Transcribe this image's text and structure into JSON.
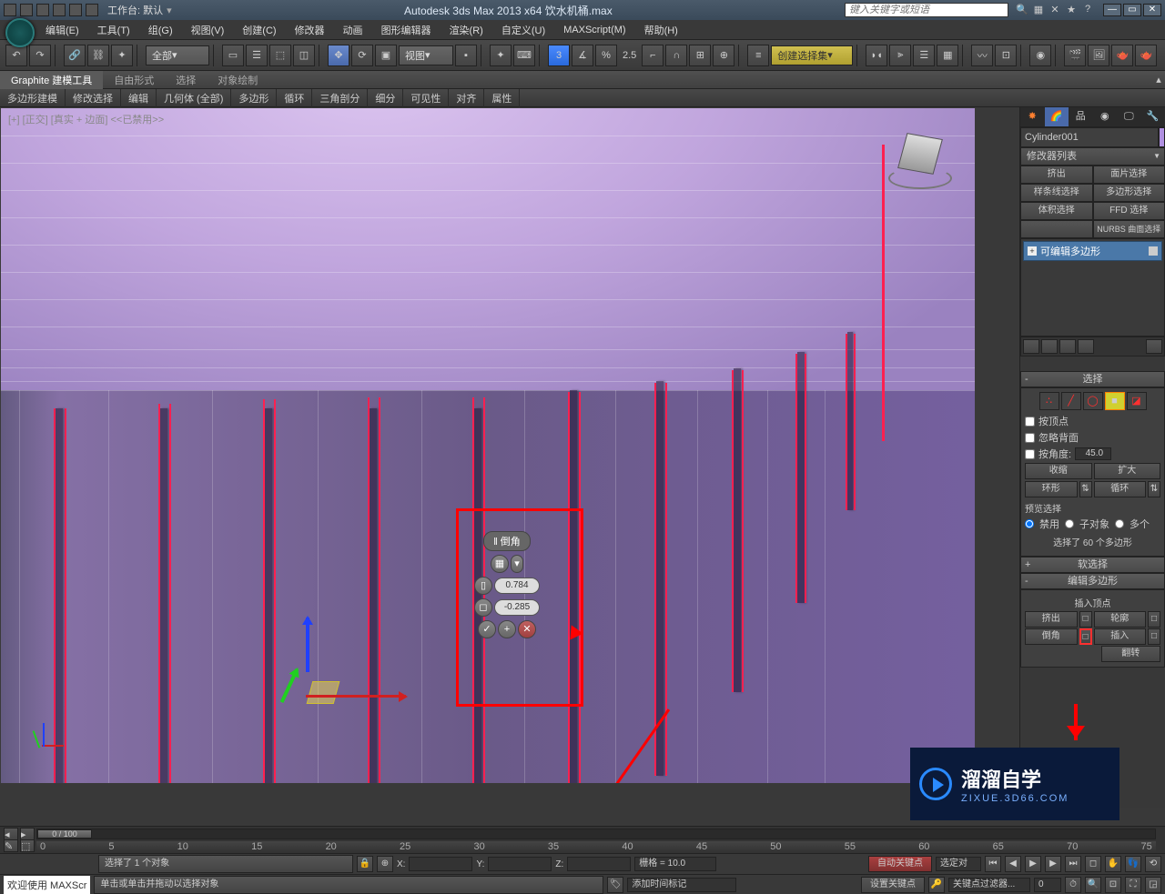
{
  "titlebar": {
    "workspace": "工作台: 默认",
    "title": "Autodesk 3ds Max  2013 x64     饮水机桶.max",
    "search_placeholder": "键入关键字或短语"
  },
  "menu": [
    "编辑(E)",
    "工具(T)",
    "组(G)",
    "视图(V)",
    "创建(C)",
    "修改器",
    "动画",
    "图形编辑器",
    "渲染(R)",
    "自定义(U)",
    "MAXScript(M)",
    "帮助(H)"
  ],
  "toolbar": {
    "filter_all": "全部",
    "ref_coord": "视图",
    "scale_label": "2.5",
    "named_sel": "创建选择集"
  },
  "ribbon_tabs": [
    "Graphite 建模工具",
    "自由形式",
    "选择",
    "对象绘制"
  ],
  "ribbon_panels": [
    "多边形建模",
    "修改选择",
    "编辑",
    "几何体 (全部)",
    "多边形",
    "循环",
    "三角剖分",
    "细分",
    "可见性",
    "对齐",
    "属性"
  ],
  "viewport_label": "[+] [正交] [真实 + 边面]  <<已禁用>>",
  "caddy": {
    "title": "‖ 倒角",
    "val1": "0.784",
    "val2": "-0.285"
  },
  "cmd": {
    "object_name": "Cylinder001",
    "modifier_list": "修改器列表",
    "mod_btns": [
      "挤出",
      "面片选择",
      "样条线选择",
      "多边形选择",
      "体积选择",
      "FFD 选择",
      "",
      "NURBS 曲面选择"
    ],
    "stack_item": "可编辑多边形",
    "rollout_selection": "选择",
    "chk_by_vertex": "按顶点",
    "chk_ignore_backface": "忽略背面",
    "chk_by_angle": "按角度:",
    "angle_val": "45.0",
    "btn_shrink": "收缩",
    "btn_grow": "扩大",
    "btn_ring": "环形",
    "btn_loop": "循环",
    "preview_label": "预览选择",
    "radio_disable": "禁用",
    "radio_subobj": "子对象",
    "radio_multi": "多个",
    "sel_info": "选择了 60 个多边形",
    "rollout_soft": "软选择",
    "rollout_edit_poly": "编辑多边形",
    "insert_vertex": "插入顶点",
    "btn_extrude": "挤出",
    "btn_outline": "轮廓",
    "btn_bevel": "倒角",
    "btn_inset": "插入",
    "btn_flip": "翻转"
  },
  "timeline": {
    "slider": "0 / 100",
    "ticks": [
      "0",
      "5",
      "10",
      "15",
      "20",
      "25",
      "30",
      "35",
      "40",
      "45",
      "50",
      "55",
      "60",
      "65",
      "70",
      "75"
    ]
  },
  "status": {
    "sel_count": "选择了 1 个对象",
    "prompt": "单击或单击并拖动以选择对象",
    "x": "X:",
    "y": "Y:",
    "z": "Z:",
    "grid": "栅格 = 10.0",
    "add_time_tag": "添加时间标记",
    "auto_key": "自动关键点",
    "set_key": "设置关键点",
    "sel_drop": "选定对",
    "key_filter": "关键点过滤器..."
  },
  "welcome": "欢迎使用  MAXScr",
  "watermark": {
    "main": "溜溜自学",
    "sub": "ZIXUE.3D66.COM"
  }
}
